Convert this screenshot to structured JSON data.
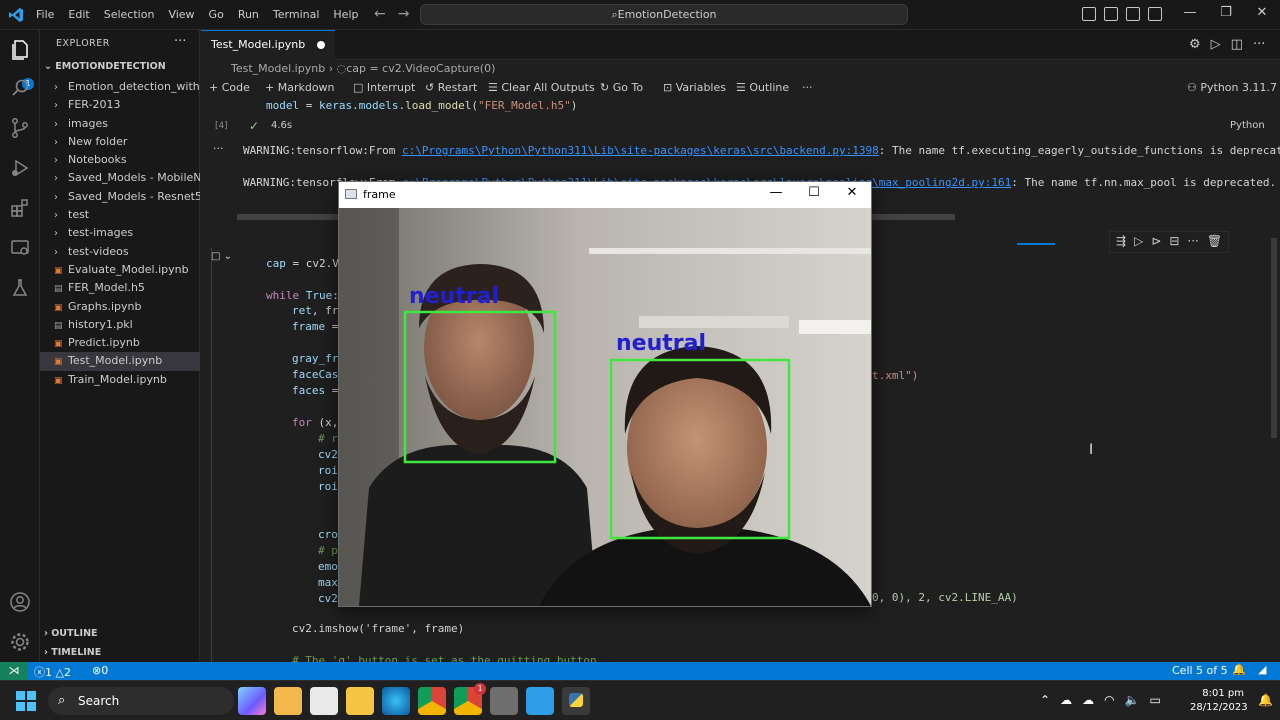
{
  "titlebar": {
    "menu": [
      "File",
      "Edit",
      "Selection",
      "View",
      "Go",
      "Run",
      "Terminal",
      "Help"
    ],
    "search_text": "EmotionDetection"
  },
  "sidebar": {
    "header": "EXPLORER",
    "root": "EMOTIONDETECTION",
    "items": [
      {
        "label": "Emotion_detection_with_...",
        "kind": "folder"
      },
      {
        "label": "FER-2013",
        "kind": "folder"
      },
      {
        "label": "images",
        "kind": "folder"
      },
      {
        "label": "New folder",
        "kind": "folder"
      },
      {
        "label": "Notebooks",
        "kind": "folder"
      },
      {
        "label": "Saved_Models - MobileN...",
        "kind": "folder"
      },
      {
        "label": "Saved_Models - Resnet50",
        "kind": "folder"
      },
      {
        "label": "test",
        "kind": "folder"
      },
      {
        "label": "test-images",
        "kind": "folder"
      },
      {
        "label": "test-videos",
        "kind": "folder"
      },
      {
        "label": "Evaluate_Model.ipynb",
        "kind": "notebook"
      },
      {
        "label": "FER_Model.h5",
        "kind": "file"
      },
      {
        "label": "Graphs.ipynb",
        "kind": "notebook"
      },
      {
        "label": "history1.pkl",
        "kind": "file"
      },
      {
        "label": "Predict.ipynb",
        "kind": "notebook"
      },
      {
        "label": "Test_Model.ipynb",
        "kind": "notebook",
        "active": true
      },
      {
        "label": "Train_Model.ipynb",
        "kind": "notebook"
      }
    ],
    "outline": "OUTLINE",
    "timeline": "TIMELINE",
    "badge": "1"
  },
  "editor": {
    "tab_label": "Test_Model.ipynb",
    "breadcrumb_file": "Test_Model.ipynb",
    "breadcrumb_symbol": "cap = cv2.VideoCapture(0)",
    "toolbar": {
      "code": "Code",
      "markdown": "Markdown",
      "interrupt": "Interrupt",
      "restart": "Restart",
      "clear": "Clear All Outputs",
      "goto": "Go To",
      "variables": "Variables",
      "outline": "Outline",
      "kernel": "Python 3.11.7"
    },
    "cell4": {
      "exec_count": "[4]",
      "duration": "4.6s",
      "language": "Python",
      "warnings": [
        {
          "prefix": "WARNING:tensorflow:From ",
          "path": "c:\\Programs\\Python\\Python311\\Lib\\site-packages\\keras\\src\\backend.py:1398",
          "suffix": ": The name tf.executing_eagerly_outside_functions is deprecated."
        },
        {
          "prefix": "WARNING:tensorflow:From ",
          "path": "c:\\Programs\\Python\\Python311\\Lib\\site-packages\\keras\\src\\layers\\pooling\\max_pooling2d.py:161",
          "suffix": ": The name tf.nn.max_pool is deprecated. Ple"
        }
      ]
    },
    "cell5_tail": {
      "line_xml": "t.xml\")",
      "line_puttext": "0, 0), 2, cv2.LINE_AA)",
      "line_imshow": "cv2.imshow('frame', frame)",
      "line_comment": "# The 'q' button is set as the quitting button"
    }
  },
  "frame_window": {
    "title": "frame",
    "label1": "neutral",
    "label2": "neutral"
  },
  "statusbar": {
    "errors": "1",
    "warnings": "2",
    "ports": "0",
    "cell": "Cell 5 of 5"
  },
  "taskbar": {
    "search": "Search",
    "time": "8:01 pm",
    "date": "28/12/2023",
    "chrome_badge": "1"
  }
}
